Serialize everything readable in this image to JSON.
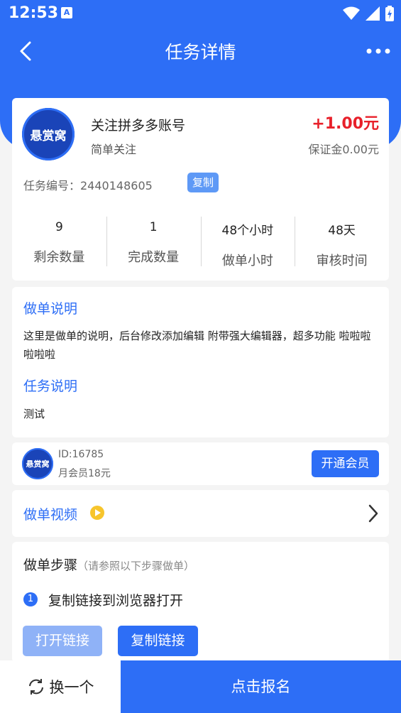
{
  "status": {
    "time": "12:53",
    "notification_letter": "A"
  },
  "nav": {
    "title": "任务详情"
  },
  "task": {
    "logo_text": "悬赏窝",
    "title": "关注拼多多账号",
    "subtitle": "简单关注",
    "reward": "+1.00元",
    "deposit": "保证金0.00元",
    "number": "任务编号：2440148605",
    "copy_label": "复制"
  },
  "stats": [
    {
      "value": "9",
      "label": "剩余数量"
    },
    {
      "value": "1",
      "label": "完成数量"
    },
    {
      "value": "48个小时",
      "label": "做单小时"
    },
    {
      "value": "48天",
      "label": "审核时间"
    }
  ],
  "description": {
    "order_heading": "做单说明",
    "order_text": "这里是做单的说明，后台修改添加编辑 附带强大编辑器，超多功能 啦啦啦啦啦啦",
    "task_heading": "任务说明",
    "task_text": "测试"
  },
  "member": {
    "logo_text": "悬赏窝",
    "id": "ID:16785",
    "price": "月会员18元",
    "button": "开通会员"
  },
  "video": {
    "label": "做单视频"
  },
  "steps": {
    "title": "做单步骤",
    "hint": "（请参照以下步骤做单）",
    "items": [
      {
        "num": "1",
        "text": "复制链接到浏览器打开"
      }
    ],
    "open_link": "打开链接",
    "copy_link": "复制链接"
  },
  "bottom": {
    "swap": "换一个",
    "signup": "点击报名"
  },
  "colors": {
    "primary": "#2d6ef6",
    "reward": "#e8202a"
  }
}
